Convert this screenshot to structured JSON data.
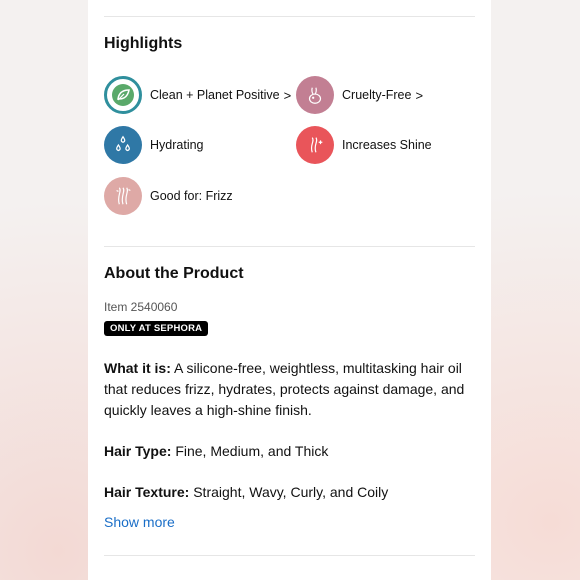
{
  "highlights": {
    "title": "Highlights",
    "items": [
      {
        "label": "Clean + Planet Positive",
        "chevron": true,
        "icon": "leaf-planet-icon",
        "color": "#2f8f9d"
      },
      {
        "label": "Cruelty-Free",
        "chevron": true,
        "icon": "rabbit-icon",
        "color": "#c27f93"
      },
      {
        "label": "Hydrating",
        "chevron": false,
        "icon": "water-drops-icon",
        "color": "#2f78a6"
      },
      {
        "label": "Increases Shine",
        "chevron": false,
        "icon": "shine-icon",
        "color": "#e9555a"
      },
      {
        "label": "Good for: Frizz",
        "chevron": false,
        "icon": "frizz-icon",
        "color": "#dea9a6"
      }
    ]
  },
  "about": {
    "title": "About the Product",
    "item_number": "Item 2540060",
    "badge": "ONLY AT SEPHORA",
    "what_label": "What it is:",
    "what_text": " A silicone-free, weightless, multitasking hair oil that reduces frizz, hydrates, protects against damage, and quickly leaves a high-shine finish.",
    "hair_type_label": "Hair Type:",
    "hair_type_text": " Fine, Medium, and Thick",
    "hair_texture_label": "Hair Texture:",
    "hair_texture_text": " Straight, Wavy, Curly, and Coily",
    "show_more": "Show more"
  },
  "chevron_glyph": ">"
}
